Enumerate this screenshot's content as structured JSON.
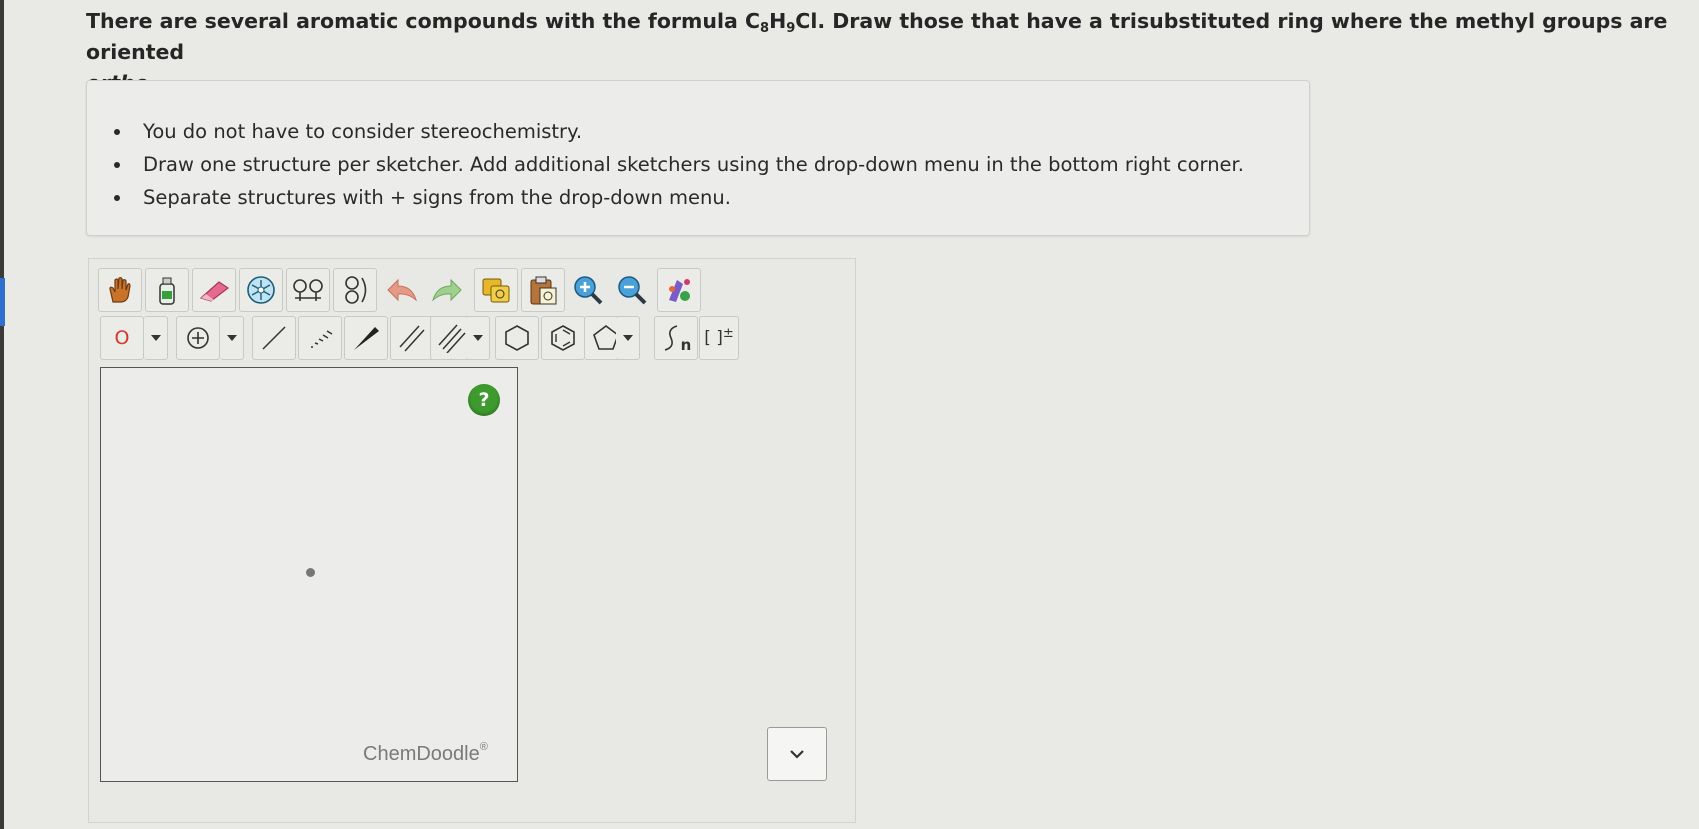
{
  "question": {
    "part1": "There are several aromatic compounds with the formula C",
    "sub1": "8",
    "part2": "H",
    "sub2": "9",
    "part3": "Cl. Draw those that have a trisubstituted ring where the methyl groups are oriented",
    "italic": "ortho",
    "end": "."
  },
  "instructions": [
    "You do not have to consider stereochemistry.",
    "Draw one structure per sketcher. Add additional sketchers using the drop-down menu in the bottom right corner.",
    "Separate structures with + signs from the drop-down menu."
  ],
  "toolbar": {
    "atom_label": "O",
    "polymer_label": "n",
    "bracket_label": "[ ]",
    "bracket_sup": "±"
  },
  "sketcher": {
    "help_label": "?",
    "brand": "ChemDoodle",
    "brand_mark": "®"
  },
  "colors": {
    "accent_blue": "#2f6fd0",
    "help_green": "#3e9a2e",
    "atom_red": "#d23a2a"
  }
}
